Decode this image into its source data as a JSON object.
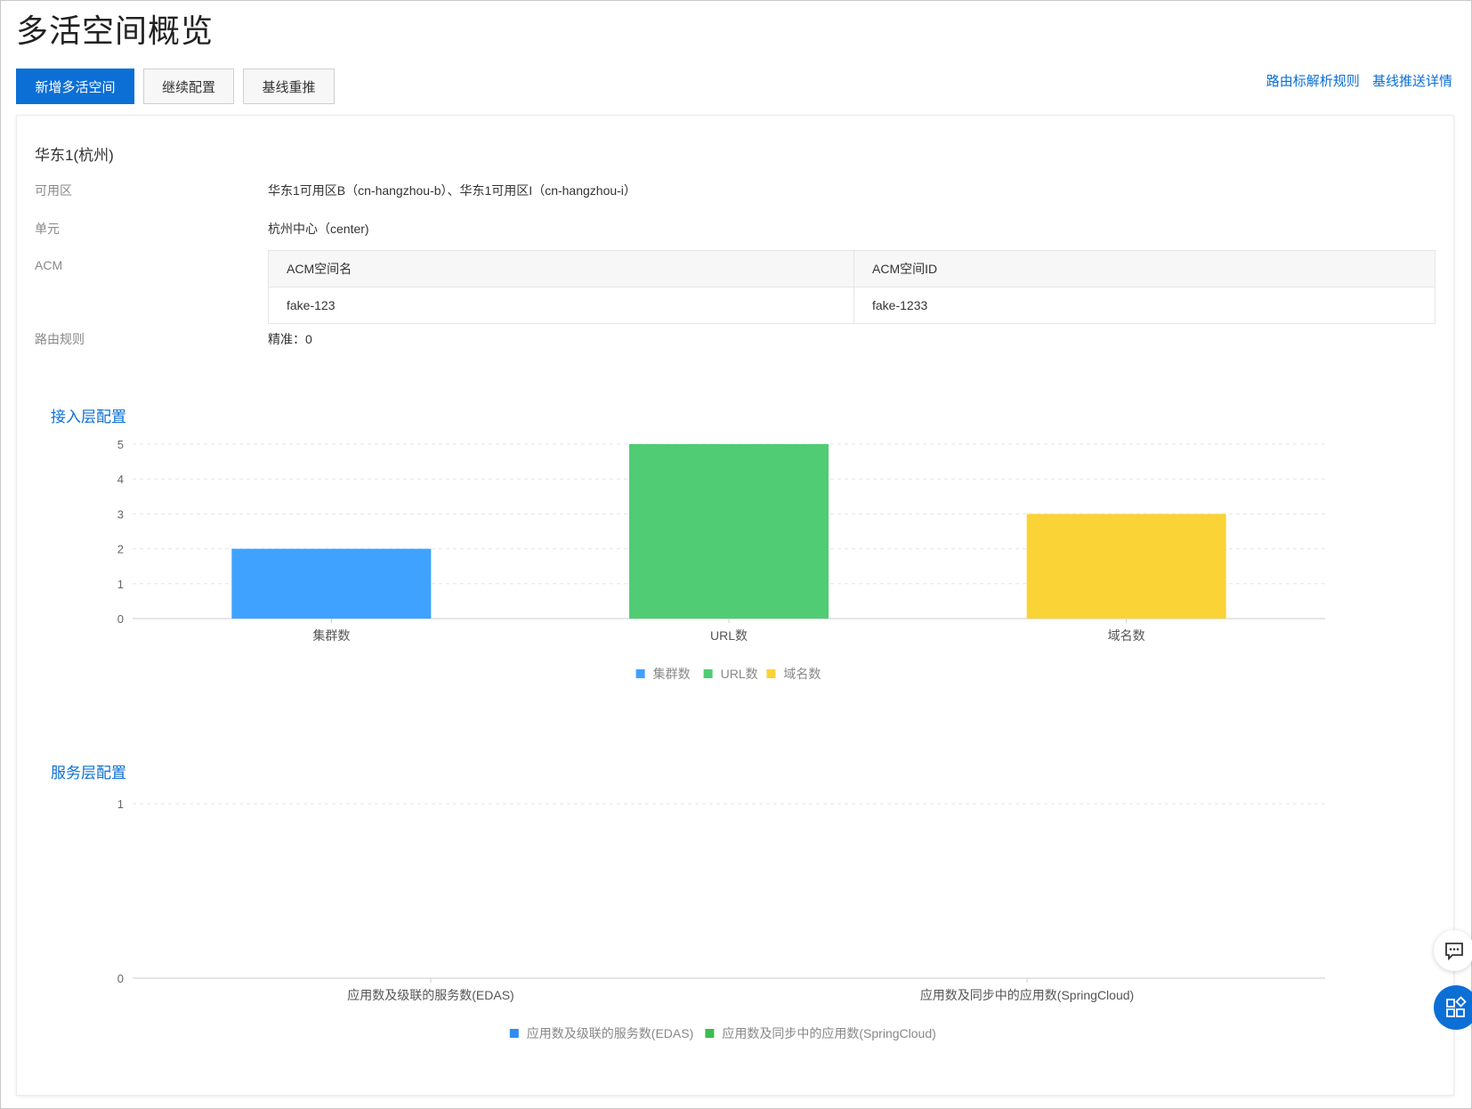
{
  "page": {
    "title": "多活空间概览"
  },
  "toolbar": {
    "add_label": "新增多活空间",
    "continue_label": "继续配置",
    "rebase_label": "基线重推"
  },
  "links": {
    "routing_rules": "路由标解析规则",
    "baseline_details": "基线推送详情"
  },
  "region": {
    "title": "华东1(杭州)",
    "az_label": "可用区",
    "az_value": "华东1可用区B（cn-hangzhou-b）、华东1可用区I（cn-hangzhou-i）",
    "unit_label": "单元",
    "unit_value": "杭州中心（center)",
    "acm_label": "ACM",
    "acm_table": {
      "headers": [
        "ACM空间名",
        "ACM空间ID"
      ],
      "rows": [
        [
          "fake-123",
          "fake-1233"
        ]
      ]
    },
    "route_label": "路由规则",
    "route_value": "精准：0"
  },
  "sections": {
    "access": "接入层配置",
    "service": "服务层配置"
  },
  "chart_data": [
    {
      "type": "bar",
      "title": "",
      "categories": [
        "集群数",
        "URL数",
        "域名数"
      ],
      "values": [
        2,
        5,
        3
      ],
      "colors": [
        "#3fa2ff",
        "#50cc74",
        "#fad337"
      ],
      "ylim": [
        0,
        5
      ],
      "yticks": [
        "0",
        "1",
        "2",
        "3",
        "4",
        "5"
      ],
      "legend": [
        "集群数",
        "URL数",
        "域名数"
      ],
      "legend_position": "bottom-center",
      "grid": true
    },
    {
      "type": "bar",
      "title": "",
      "categories": [
        "应用数及级联的服务数(EDAS)",
        "应用数及同步中的应用数(SpringCloud)"
      ],
      "values": [
        0,
        0
      ],
      "colors": [
        "#2e8cf0",
        "#3dbb4f"
      ],
      "ylim": [
        0,
        1
      ],
      "yticks": [
        "0",
        "1"
      ],
      "legend": [
        "应用数及级联的服务数(EDAS)",
        "应用数及同步中的应用数(SpringCloud)"
      ],
      "legend_position": "bottom-center",
      "grid": true
    }
  ],
  "icons": {
    "chat": "chat-icon",
    "apps": "apps-icon"
  }
}
